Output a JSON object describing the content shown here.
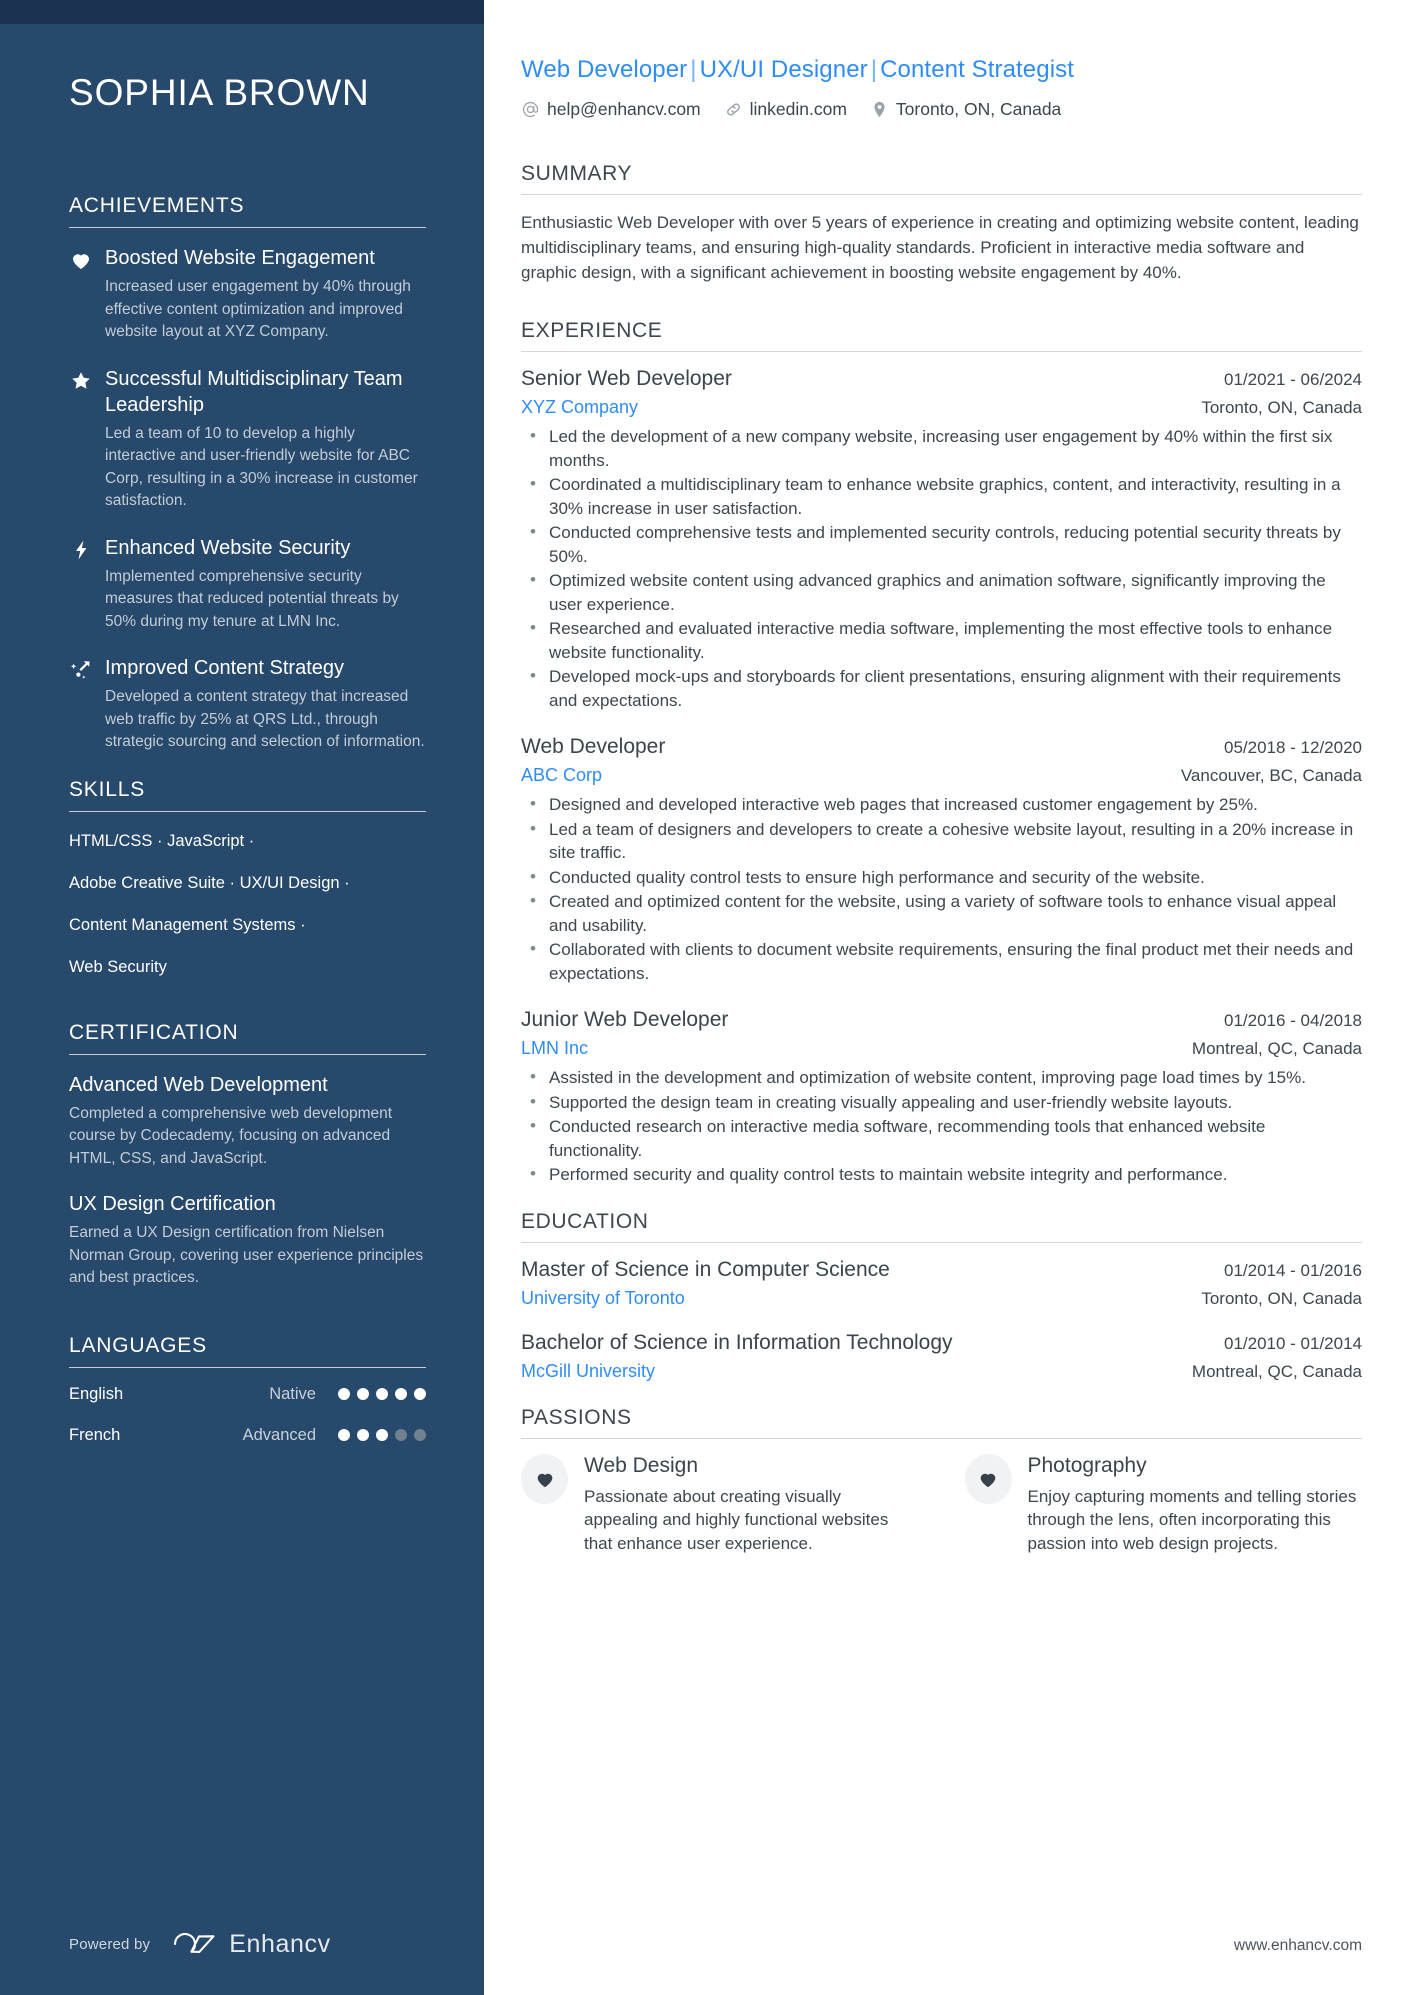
{
  "colors": {
    "sidebar_bg": "#27496b",
    "sidebar_topbar": "#1b3350",
    "accent_blue": "#2f8cf7",
    "body_text": "#3c474f"
  },
  "sidebar": {
    "name": "SOPHIA BROWN",
    "achievements": {
      "title": "ACHIEVEMENTS",
      "items": [
        {
          "icon": "heart-icon",
          "title": "Boosted Website Engagement",
          "desc": "Increased user engagement by 40% through effective content optimization and improved website layout at XYZ Company."
        },
        {
          "icon": "star-icon",
          "title": "Successful Multidisciplinary Team Leadership",
          "desc": "Led a team of 10 to develop a highly interactive and user-friendly website for ABC Corp, resulting in a 30% increase in customer satisfaction."
        },
        {
          "icon": "lightning-bolt-icon",
          "title": "Enhanced Website Security",
          "desc": "Implemented comprehensive security measures that reduced potential threats by 50% during my tenure at LMN Inc."
        },
        {
          "icon": "trending-up-icon",
          "title": "Improved Content Strategy",
          "desc": "Developed a content strategy that increased web traffic by 25% at QRS Ltd., through strategic sourcing and selection of information."
        }
      ]
    },
    "skills": {
      "title": "SKILLS",
      "lines": [
        "HTML/CSS · JavaScript ·",
        "Adobe Creative Suite · UX/UI Design ·",
        "Content Management Systems ·",
        "Web Security"
      ],
      "items": [
        "HTML/CSS",
        "JavaScript",
        "Adobe Creative Suite",
        "UX/UI Design",
        "Content Management Systems",
        "Web Security"
      ]
    },
    "certification": {
      "title": "CERTIFICATION",
      "items": [
        {
          "title": "Advanced Web Development",
          "desc": "Completed a comprehensive web development course by Codecademy, focusing on advanced HTML, CSS, and JavaScript."
        },
        {
          "title": "UX Design Certification",
          "desc": "Earned a UX Design certification from Nielsen Norman Group, covering user experience principles and best practices."
        }
      ]
    },
    "languages": {
      "title": "LANGUAGES",
      "items": [
        {
          "name": "English",
          "level": "Native",
          "filled": 5,
          "total": 5
        },
        {
          "name": "French",
          "level": "Advanced",
          "filled": 3,
          "total": 5
        }
      ]
    },
    "footer": {
      "powered_by": "Powered by",
      "brand": "Enhancv"
    }
  },
  "main": {
    "headline": {
      "part1": "Web Developer",
      "sep1": "|",
      "part2": "UX/UI Designer",
      "sep2": "|",
      "part3": "Content Strategist"
    },
    "contacts": [
      {
        "icon": "at-email-icon",
        "text": "help@enhancv.com"
      },
      {
        "icon": "link-icon",
        "text": "linkedin.com"
      },
      {
        "icon": "location-pin-icon",
        "text": "Toronto, ON, Canada"
      }
    ],
    "summary": {
      "title": "SUMMARY",
      "text": "Enthusiastic Web Developer with over 5 years of experience in creating and optimizing website content, leading multidisciplinary teams, and ensuring high-quality standards. Proficient in interactive media software and graphic design, with a significant achievement in boosting website engagement by 40%."
    },
    "experience": {
      "title": "EXPERIENCE",
      "jobs": [
        {
          "title": "Senior Web Developer",
          "dates": "01/2021 - 06/2024",
          "company": "XYZ Company",
          "location": "Toronto, ON, Canada",
          "bullets": [
            "Led the development of a new company website, increasing user engagement by 40% within the first six months.",
            "Coordinated a multidisciplinary team to enhance website graphics, content, and interactivity, resulting in a 30% increase in user satisfaction.",
            "Conducted comprehensive tests and implemented security controls, reducing potential security threats by 50%.",
            "Optimized website content using advanced graphics and animation software, significantly improving the user experience.",
            "Researched and evaluated interactive media software, implementing the most effective tools to enhance website functionality.",
            "Developed mock-ups and storyboards for client presentations, ensuring alignment with their requirements and expectations."
          ]
        },
        {
          "title": "Web Developer",
          "dates": "05/2018 - 12/2020",
          "company": "ABC Corp",
          "location": "Vancouver, BC, Canada",
          "bullets": [
            "Designed and developed interactive web pages that increased customer engagement by 25%.",
            "Led a team of designers and developers to create a cohesive website layout, resulting in a 20% increase in site traffic.",
            "Conducted quality control tests to ensure high performance and security of the website.",
            "Created and optimized content for the website, using a variety of software tools to enhance visual appeal and usability.",
            "Collaborated with clients to document website requirements, ensuring the final product met their needs and expectations."
          ]
        },
        {
          "title": "Junior Web Developer",
          "dates": "01/2016 - 04/2018",
          "company": "LMN Inc",
          "location": "Montreal, QC, Canada",
          "bullets": [
            "Assisted in the development and optimization of website content, improving page load times by 15%.",
            "Supported the design team in creating visually appealing and user-friendly website layouts.",
            "Conducted research on interactive media software, recommending tools that enhanced website functionality.",
            "Performed security and quality control tests to maintain website integrity and performance."
          ]
        }
      ]
    },
    "education": {
      "title": "EDUCATION",
      "items": [
        {
          "degree": "Master of Science in Computer Science",
          "dates": "01/2014 - 01/2016",
          "school": "University of Toronto",
          "location": "Toronto, ON, Canada"
        },
        {
          "degree": "Bachelor of Science in Information Technology",
          "dates": "01/2010 - 01/2014",
          "school": "McGill University",
          "location": "Montreal, QC, Canada"
        }
      ]
    },
    "passions": {
      "title": "PASSIONS",
      "items": [
        {
          "icon": "heart-icon",
          "title": "Web Design",
          "desc": "Passionate about creating visually appealing and highly functional websites that enhance user experience."
        },
        {
          "icon": "heart-icon",
          "title": "Photography",
          "desc": "Enjoy capturing moments and telling stories through the lens, often incorporating this passion into web design projects."
        }
      ]
    },
    "footer_url": "www.enhancv.com"
  }
}
